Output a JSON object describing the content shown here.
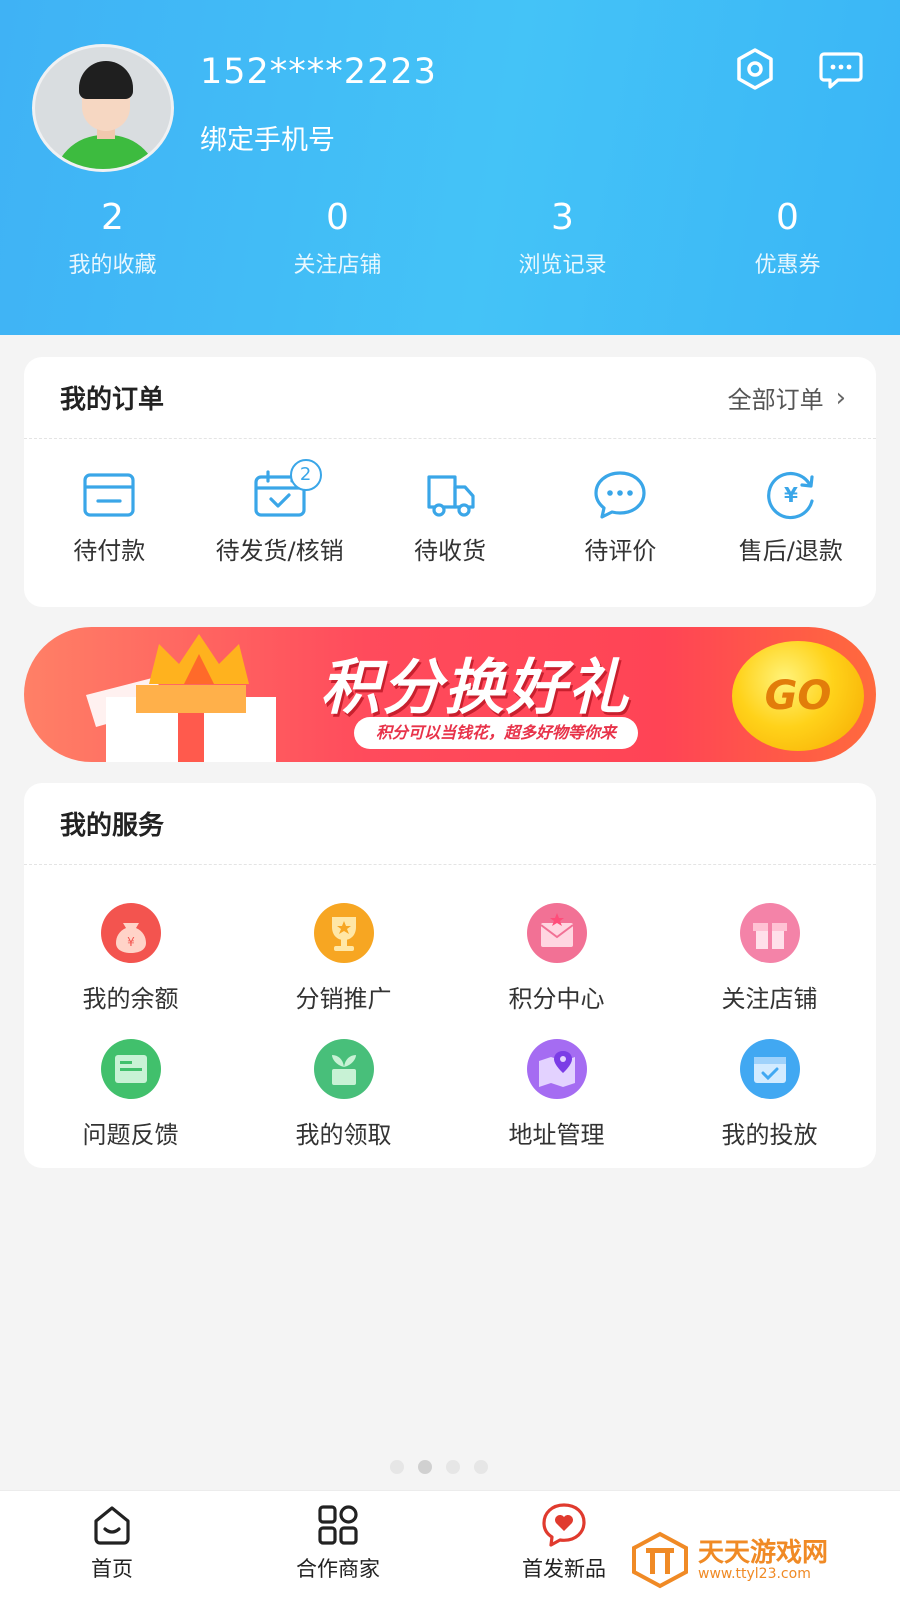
{
  "profile": {
    "phone": "152****2223",
    "bind_phone_label": "绑定手机号"
  },
  "stats": [
    {
      "value": "2",
      "label": "我的收藏"
    },
    {
      "value": "0",
      "label": "关注店铺"
    },
    {
      "value": "3",
      "label": "浏览记录"
    },
    {
      "value": "0",
      "label": "优惠券"
    }
  ],
  "orders": {
    "title": "我的订单",
    "all_label": "全部订单",
    "items": [
      {
        "label": "待付款",
        "icon": "wallet-icon"
      },
      {
        "label": "待发货/核销",
        "icon": "calendar-check-icon",
        "badge": "2"
      },
      {
        "label": "待收货",
        "icon": "truck-icon"
      },
      {
        "label": "待评价",
        "icon": "chat-bubble-icon"
      },
      {
        "label": "售后/退款",
        "icon": "yuan-refund-icon"
      }
    ]
  },
  "banner": {
    "title": "积分换好礼",
    "subtitle": "积分可以当钱花，超多好物等你来",
    "go_label": "GO"
  },
  "services": {
    "title": "我的服务",
    "items": [
      {
        "label": "我的余额",
        "icon": "money-bag-icon",
        "color": "#f0514d"
      },
      {
        "label": "分销推广",
        "icon": "trophy-icon",
        "color": "#f5a623"
      },
      {
        "label": "积分中心",
        "icon": "envelope-star-icon",
        "color": "#f06a8c"
      },
      {
        "label": "关注店铺",
        "icon": "gift-shop-icon",
        "color": "#f07aa0"
      },
      {
        "label": "问题反馈",
        "icon": "feedback-card-icon",
        "color": "#3dbf6a"
      },
      {
        "label": "我的领取",
        "icon": "sprout-box-icon",
        "color": "#46c07a"
      },
      {
        "label": "地址管理",
        "icon": "map-pin-icon",
        "color": "#a26bf0"
      },
      {
        "label": "我的投放",
        "icon": "calendar-icon",
        "color": "#3ea6f2"
      }
    ]
  },
  "nav": {
    "home": "首页",
    "partners": "合作商家",
    "new": "首发新品"
  },
  "watermark": {
    "name": "天天游戏网",
    "url": "www.ttyl23.com"
  },
  "colors": {
    "header_start": "#3fb2f5",
    "accent_blue": "#3aa6e8",
    "banner_red": "#ff4b5c"
  }
}
